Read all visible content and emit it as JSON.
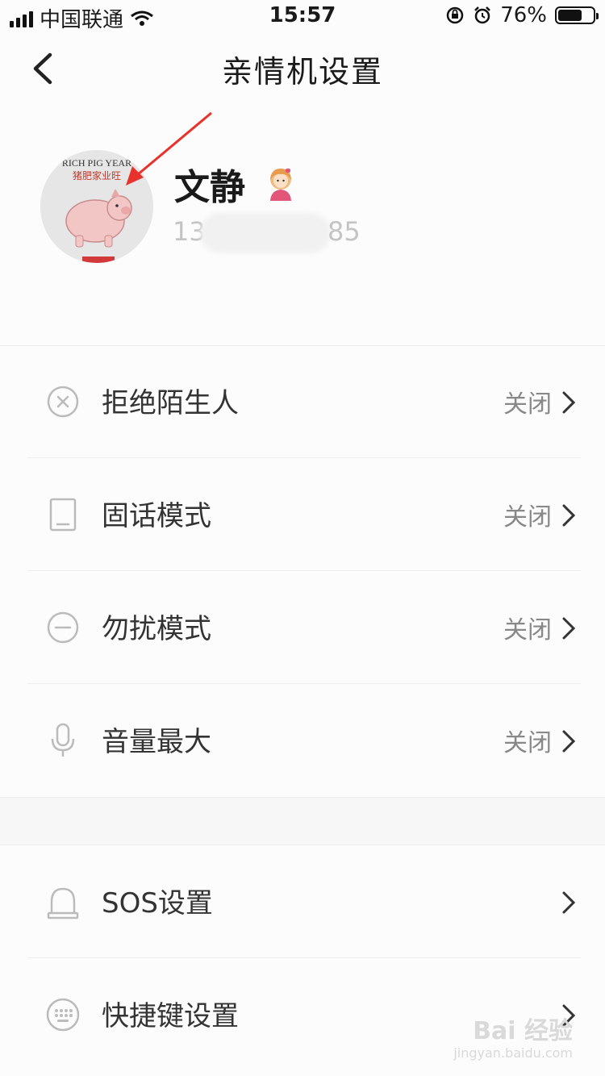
{
  "status_bar": {
    "carrier": "中国联通",
    "time": "15:57",
    "battery": "76%",
    "battery_level": 0.76
  },
  "header": {
    "title": "亲情机设置",
    "back_icon": "chevron-left-icon"
  },
  "profile": {
    "avatar_text_top": "RICH PIG YEAR",
    "avatar_text_mid": "猪肥家业旺",
    "name": "文静",
    "badge_icon": "girl-avatar-icon",
    "phone_start": "13",
    "phone_end": "85"
  },
  "settings_group_1": [
    {
      "label": "拒绝陌生人",
      "value": "关闭",
      "icon": "x-circle-icon"
    },
    {
      "label": "固话模式",
      "value": "关闭",
      "icon": "phone-handset-icon"
    },
    {
      "label": "勿扰模式",
      "value": "关闭",
      "icon": "minus-circle-icon"
    },
    {
      "label": "音量最大",
      "value": "关闭",
      "icon": "microphone-icon"
    }
  ],
  "settings_group_2": [
    {
      "label": "SOS设置",
      "icon": "siren-icon"
    },
    {
      "label": "快捷键设置",
      "icon": "keypad-icon"
    }
  ],
  "watermark": {
    "brand": "Bai 经验",
    "url": "jingyan.baidu.com"
  },
  "colors": {
    "background": "#fcfcfc",
    "text_primary": "#1a1a1a",
    "text_secondary": "#888888",
    "annotation_arrow": "#e8322c"
  }
}
